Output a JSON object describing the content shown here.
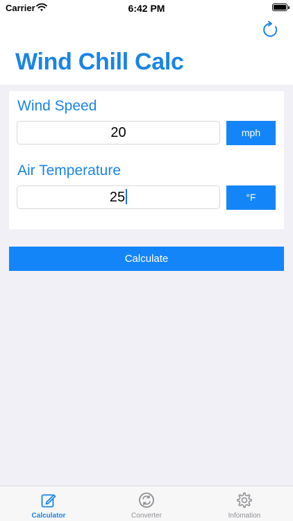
{
  "status_bar": {
    "carrier": "Carrier",
    "time": "6:42 PM"
  },
  "header": {
    "title": "Wind Chill Calc",
    "refresh_icon": "refresh-icon"
  },
  "form": {
    "wind_speed": {
      "label": "Wind Speed",
      "value": "20",
      "unit": "mph"
    },
    "air_temperature": {
      "label": "Air Temperature",
      "value": "25",
      "unit": "°F"
    }
  },
  "calculate_label": "Calculate",
  "tabs": [
    {
      "label": "Calculator",
      "icon": "edit-icon",
      "active": true
    },
    {
      "label": "Converter",
      "icon": "convert-icon",
      "active": false
    },
    {
      "label": "Infomation",
      "icon": "gear-icon",
      "active": false
    }
  ],
  "colors": {
    "accent": "#1a84e6",
    "button": "#1485f9",
    "background": "#f0f0f6"
  }
}
